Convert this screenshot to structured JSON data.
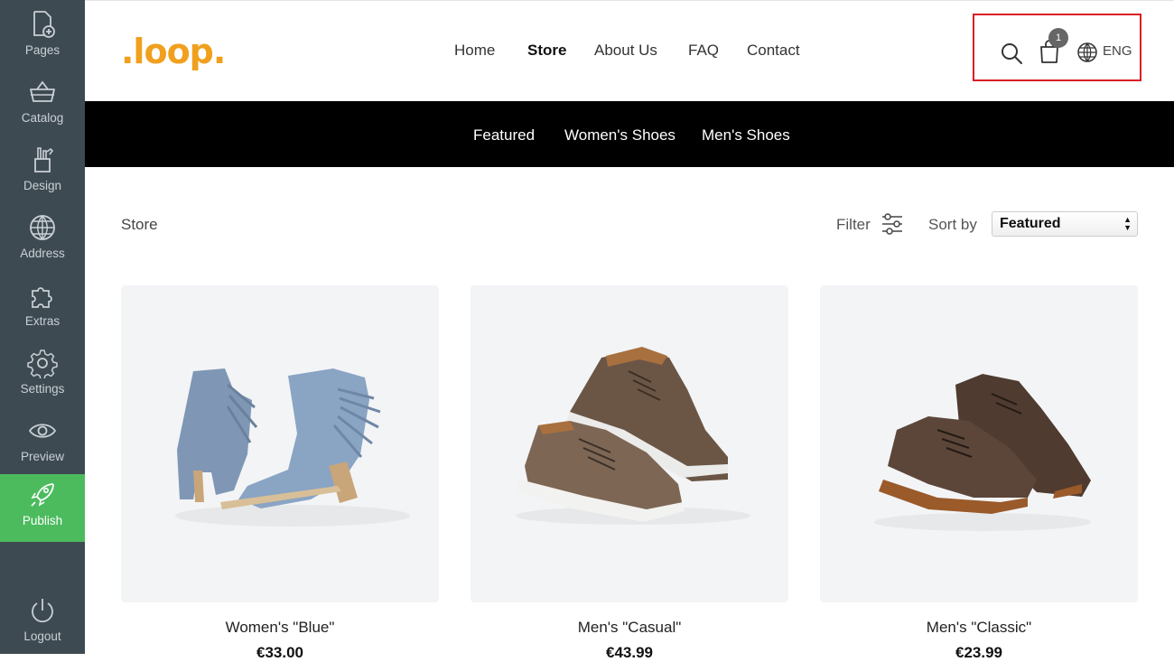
{
  "sidebar": {
    "items": [
      {
        "label": "Pages",
        "icon": "page-add-icon"
      },
      {
        "label": "Catalog",
        "icon": "basket-icon"
      },
      {
        "label": "Design",
        "icon": "design-tools-icon"
      },
      {
        "label": "Address",
        "icon": "globe-icon"
      },
      {
        "label": "Extras",
        "icon": "puzzle-icon"
      },
      {
        "label": "Settings",
        "icon": "gear-icon"
      },
      {
        "label": "Preview",
        "icon": "eye-icon"
      },
      {
        "label": "Publish",
        "icon": "rocket-icon",
        "active": true
      }
    ],
    "logout": {
      "label": "Logout",
      "icon": "power-icon"
    },
    "colors": {
      "background": "#3e4a52",
      "active": "#4cbb5e"
    }
  },
  "header": {
    "logo": ".loop.",
    "logo_color": "#f0a01e",
    "nav": [
      "Home",
      "Store",
      "About Us",
      "FAQ",
      "Contact"
    ],
    "active_nav": "Store",
    "cart_count": "1",
    "language": "ENG",
    "highlight_color": "#d81f26"
  },
  "categories": [
    "Featured",
    "Women's Shoes",
    "Men's Shoes"
  ],
  "store_toolbar": {
    "breadcrumb": "Store",
    "filter_label": "Filter",
    "sort_label": "Sort by",
    "sort_value": "Featured"
  },
  "products": [
    {
      "name": "Women's \"Blue\"",
      "price": "€33.00",
      "image": "blue-fringe-boots"
    },
    {
      "name": "Men's \"Casual\"",
      "price": "€43.99",
      "image": "brown-casual-sneakers"
    },
    {
      "name": "Men's \"Classic\"",
      "price": "€23.99",
      "image": "brown-oxford-shoes"
    }
  ]
}
